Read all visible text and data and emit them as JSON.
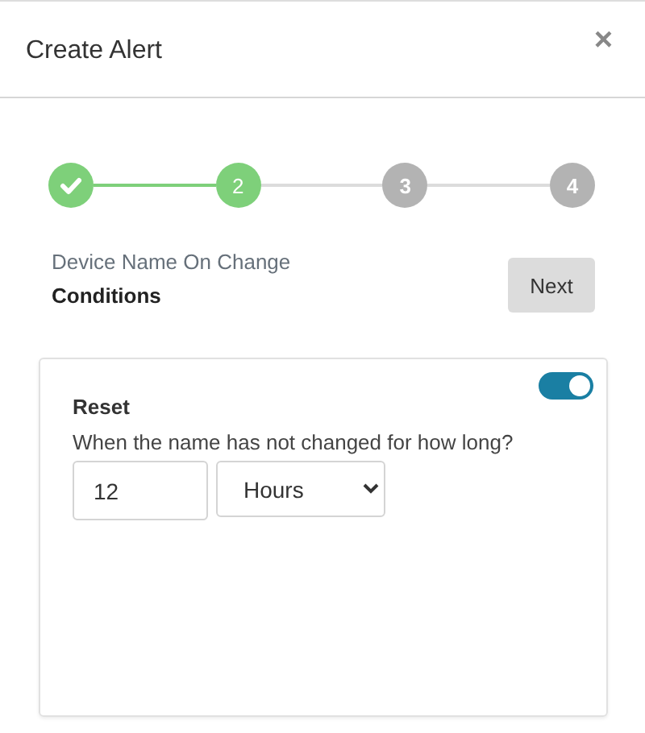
{
  "dialog": {
    "title": "Create Alert",
    "close": "×"
  },
  "steps": [
    {
      "completed": true,
      "selected": false
    },
    {
      "label": "2",
      "completed": false,
      "selected": true
    },
    {
      "label": "3",
      "completed": false,
      "selected": false
    },
    {
      "label": "4",
      "completed": false,
      "selected": false
    }
  ],
  "section": {
    "subtitle": "Device Name On Change",
    "heading": "Conditions",
    "next": "Next"
  },
  "condition": {
    "title": "Reset",
    "on": true,
    "question": "When the name has not changed for how long?",
    "amount": "12",
    "unit": "Hours"
  }
}
